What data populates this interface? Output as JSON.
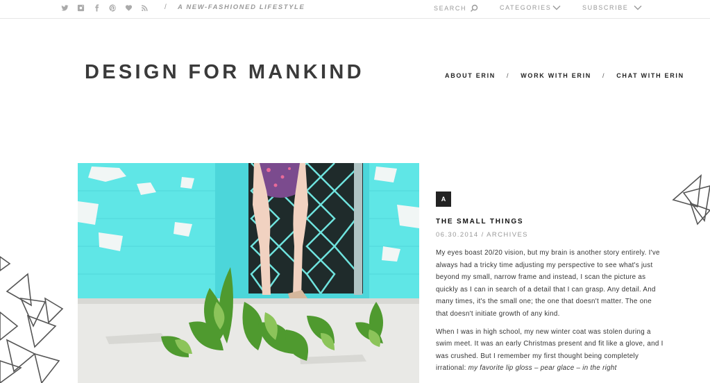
{
  "topbar": {
    "social_icons": [
      "twitter-icon",
      "instagram-icon",
      "facebook-icon",
      "pinterest-icon",
      "heart-icon",
      "rss-icon"
    ],
    "separator": "/",
    "tagline": "A NEW-FASHIONED LIFESTYLE",
    "search_label": "SEARCH",
    "categories_label": "CATEGORIES",
    "subscribe_label": "SUBSCRIBE"
  },
  "header": {
    "logo": "DESIGN FOR MANKIND",
    "nav": [
      {
        "label": "ABOUT ERIN"
      },
      {
        "label": "WORK WITH ERIN"
      },
      {
        "label": "CHAT WITH ERIN"
      }
    ],
    "nav_separator": "/"
  },
  "post": {
    "badge": "A",
    "title": "THE SMALL THINGS",
    "date": "06.30.2014",
    "meta_separator": "/",
    "category": "ARCHIVES",
    "paragraph1": "My eyes boast 20/20 vision, but my brain is another story entirely. I've always had a tricky time adjusting my perspective to see what's just beyond my small, narrow frame and instead, I scan the picture as quickly as I can in search of a detail that I can grasp. Any detail. And many times, it's the small one; the one that doesn't matter. The one that doesn't initiate growth of any kind.",
    "paragraph2_start": "When I was in high school, my new winter coat was stolen during a swim meet. It was an early Christmas present and fit like a glove, and I was crushed. But I remember my first thought being completely irrational: ",
    "paragraph2_emph": "my favorite lip gloss – pear glace – in the right"
  },
  "colors": {
    "accent_teal": "#5fe6e6",
    "text_dark": "#333333",
    "text_muted": "#999999"
  }
}
